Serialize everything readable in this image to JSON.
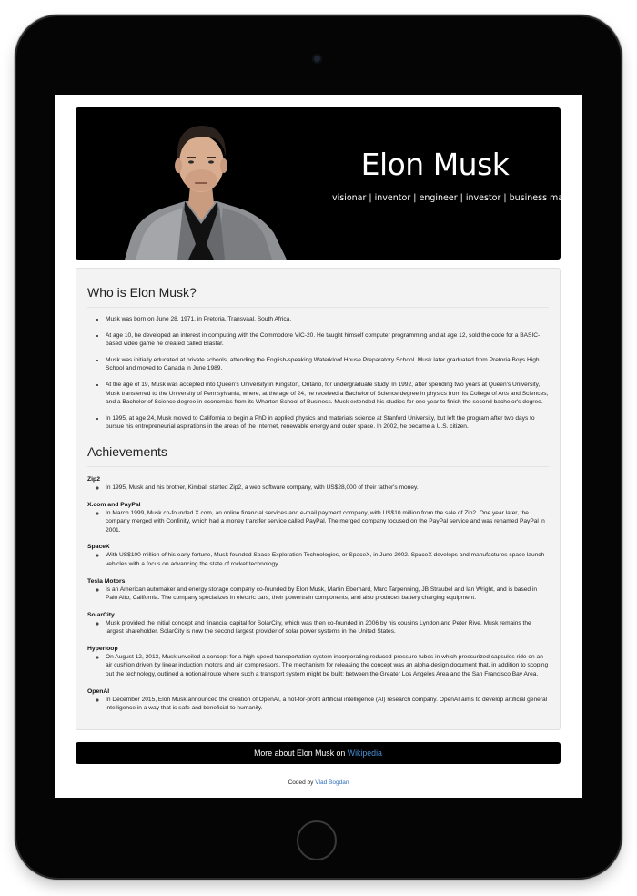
{
  "hero": {
    "name": "Elon Musk",
    "tagline": "visionar | inventor | engineer | investor | business magnat"
  },
  "bio": {
    "title": "Who is Elon Musk?",
    "items": [
      "Musk was born on June 28, 1971, in Pretoria, Transvaal, South Africa.",
      "At age 10, he developed an interest in computing with the Commodore VIC-20. He taught himself computer programming and at age 12, sold the code for a BASIC-based video game he created called Blastar.",
      "Musk was initially educated at private schools, attending the English-speaking Waterkloof House Preparatory School. Musk later graduated from Pretoria Boys High School and moved to Canada in June 1989.",
      "At the age of 19, Musk was accepted into Queen's University in Kingston, Ontario, for undergraduate study. In 1992, after spending two years at Queen's University, Musk transferred to the University of Pennsylvania, where, at the age of 24, he received a Bachelor of Science degree in physics from its College of Arts and Sciences, and a Bachelor of Science degree in economics from its Wharton School of Business. Musk extended his studies for one year to finish the second bachelor's degree.",
      "In 1995, at age 24, Musk moved to California to begin a PhD in applied physics and materials science at Stanford University, but left the program after two days to pursue his entrepreneurial aspirations in the areas of the Internet, renewable energy and outer space. In 2002, he became a U.S. citizen."
    ]
  },
  "achievements": {
    "title": "Achievements",
    "items": [
      {
        "name": "Zip2",
        "text": "In 1995, Musk and his brother, Kimbal, started Zip2, a web software company, with US$28,000 of their father's money."
      },
      {
        "name": "X.com and PayPal",
        "text": "In March 1999, Musk co-founded X.com, an online financial services and e-mail payment company, with US$10 million from the sale of Zip2. One year later, the company merged with Confinity, which had a money transfer service called PayPal. The merged company focused on the PayPal service and was renamed PayPal in 2001."
      },
      {
        "name": "SpaceX",
        "text": "With US$100 million of his early fortune, Musk founded Space Exploration Technologies, or SpaceX, in June 2002. SpaceX develops and manufactures space launch vehicles with a focus on advancing the state of rocket technology."
      },
      {
        "name": "Tesla Motors",
        "text": "Is an American automaker and energy storage company co-founded by Elon Musk, Martin Eberhard, Marc Tarpenning, JB Straubel and Ian Wright, and is based in Palo Alto, California. The company specializes in electric cars, their powertrain components, and also produces battery charging equipment."
      },
      {
        "name": "SolarCity",
        "text": "Musk provided the initial concept and financial capital for SolarCity, which was then co-founded in 2006 by his cousins Lyndon and Peter Rive. Musk remains the largest shareholder. SolarCity is now the second largest provider of solar power systems in the United States."
      },
      {
        "name": "Hyperloop",
        "text": "On August 12, 2013, Musk unveiled a concept for a high-speed transportation system incorporating reduced-pressure tubes in which pressurized capsules ride on an air cushion driven by linear induction motors and air compressors. The mechanism for releasing the concept was an alpha-design document that, in addition to scoping out the technology, outlined a notional route where such a transport system might be built: between the Greater Los Angeles Area and the San Francisco Bay Area."
      },
      {
        "name": "OpenAI",
        "text": "In December 2015, Elon Musk announced the creation of OpenAI, a not-for-profit artificial intelligence (AI) research company. OpenAI aims to develop artificial general intelligence in a way that is safe and beneficial to humanity."
      }
    ]
  },
  "more": {
    "prefix": "More about Elon Musk on",
    "link": "Wikipedia"
  },
  "footer": {
    "prefix": "Coded by",
    "author": "Vlad Bogdan"
  },
  "colors": {
    "link": "#4a8fd4",
    "banner": "#000000",
    "card": "#f3f3f3"
  }
}
